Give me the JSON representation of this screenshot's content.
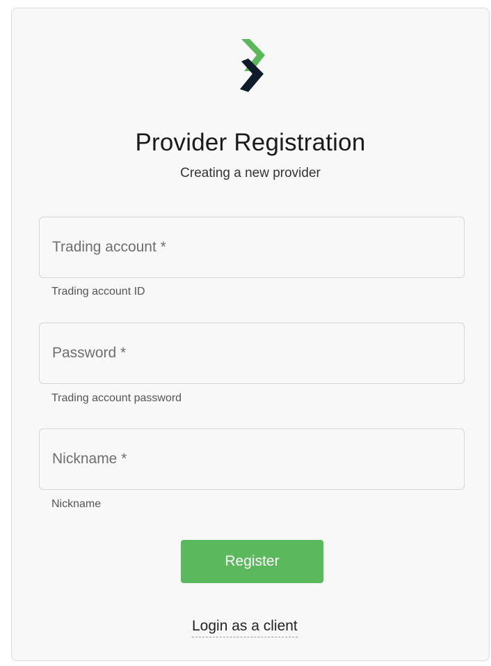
{
  "logo": {
    "icon": "brand-chevron-logo-icon",
    "colors": {
      "green": "#5cb85c",
      "dark": "#0f1a2a"
    }
  },
  "header": {
    "title": "Provider Registration",
    "subtitle": "Creating a new provider"
  },
  "form": {
    "trading_account": {
      "placeholder": "Trading account *",
      "value": "",
      "hint": "Trading account ID"
    },
    "password": {
      "placeholder": "Password *",
      "value": "",
      "hint": "Trading account password"
    },
    "nickname": {
      "placeholder": "Nickname *",
      "value": "",
      "hint": "Nickname"
    },
    "register_label": "Register"
  },
  "footer": {
    "login_link": "Login as a client"
  },
  "colors": {
    "accent": "#5cb85c",
    "card_bg": "#f8f8f8",
    "border": "#d6d6d6"
  }
}
